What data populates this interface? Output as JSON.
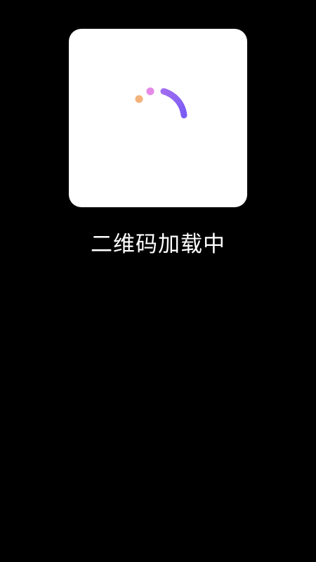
{
  "loading": {
    "message": "二维码加载中"
  },
  "spinner": {
    "icon": "loading-spinner-icon",
    "colors": {
      "arc_start": "#a06cf0",
      "arc_end": "#7a5cf5",
      "dot_pink": "#e58ae6",
      "dot_orange": "#f5b27a"
    }
  },
  "colors": {
    "background": "#000000",
    "card": "#ffffff",
    "text": "#ffffff"
  }
}
